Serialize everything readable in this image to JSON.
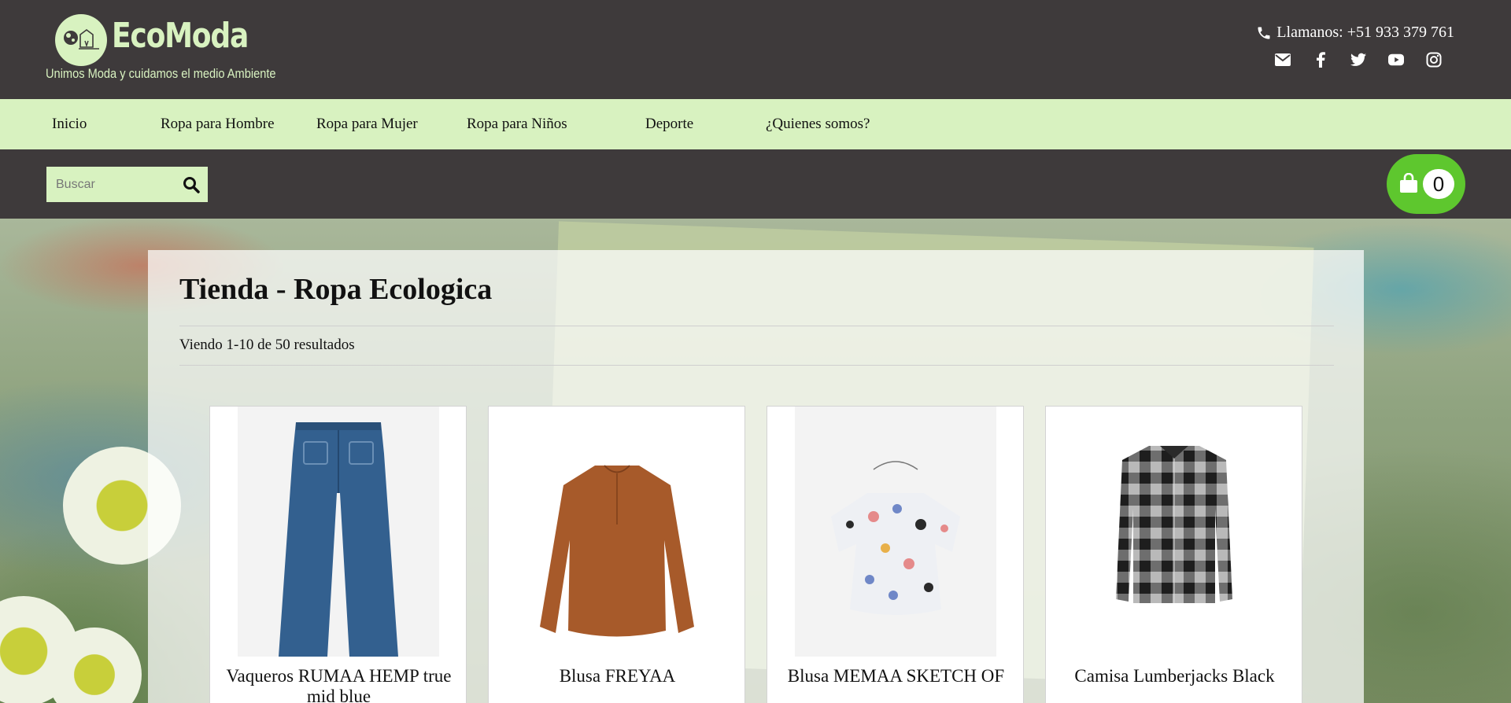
{
  "header": {
    "brand": "EcoModa",
    "tagline": "Unimos Moda y cuidamos el medio Ambiente",
    "phone": "Llamanos: +51 933 379 761",
    "socials": [
      "mail-icon",
      "facebook-icon",
      "twitter-icon",
      "youtube-icon",
      "instagram-icon"
    ]
  },
  "nav": {
    "items": [
      {
        "label": "Inicio"
      },
      {
        "label": "Ropa para Hombre"
      },
      {
        "label": "Ropa para Mujer"
      },
      {
        "label": "Ropa para Niños"
      },
      {
        "label": "Deporte"
      },
      {
        "label": "¿Quienes somos?"
      }
    ]
  },
  "search": {
    "placeholder": "Buscar"
  },
  "cart": {
    "count": "0"
  },
  "shop": {
    "title": "Tienda - Ropa Ecologica",
    "result_count": "Viendo 1-10 de 50 resultados",
    "products": [
      {
        "name": "Vaqueros RUMAA HEMP true mid blue",
        "image": "jeans"
      },
      {
        "name": "Blusa FREYAA",
        "image": "blouse-brown"
      },
      {
        "name": "Blusa MEMAA SKETCH OF",
        "image": "blouse-floral"
      },
      {
        "name": "Camisa Lumberjacks Black",
        "image": "plaid-shirt"
      }
    ]
  },
  "colors": {
    "header_bg": "#3e3a3b",
    "nav_bg": "#d8f2c0",
    "brand_green": "#d8f2c0",
    "cart_green": "#5ec72e"
  }
}
